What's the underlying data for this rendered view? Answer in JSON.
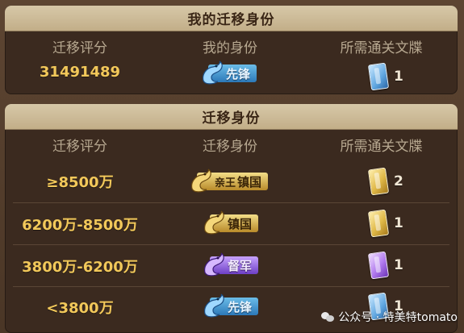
{
  "panel_mine": {
    "title": "我的迁移身份",
    "headers": [
      "迁移评分",
      "我的身份",
      "所需通关文牒"
    ],
    "score": "31491489",
    "identity": "先锋",
    "identity_style": "blue",
    "pass_count": "1",
    "pass_style": "blue"
  },
  "panel_table": {
    "title": "迁移身份",
    "headers": [
      "迁移评分",
      "迁移身份",
      "所需通关文牒"
    ],
    "rows": [
      {
        "score": "≥8500万",
        "identity": "镇国",
        "identity_prefix": "亲王",
        "identity_style": "gold",
        "pass_count": "2",
        "pass_style": "gold"
      },
      {
        "score": "6200万-8500万",
        "identity": "镇国",
        "identity_prefix": "",
        "identity_style": "gold",
        "pass_count": "1",
        "pass_style": "gold"
      },
      {
        "score": "3800万-6200万",
        "identity": "督军",
        "identity_prefix": "",
        "identity_style": "purple",
        "pass_count": "1",
        "pass_style": "purple"
      },
      {
        "score": "<3800万",
        "identity": "先锋",
        "identity_prefix": "",
        "identity_style": "blue",
        "pass_count": "1",
        "pass_style": "blue"
      }
    ]
  },
  "watermark": {
    "text": "公众号 · 特美特tomato"
  },
  "colors": {
    "score_gold": "#f2c85a",
    "header_text": "#b7a890",
    "panel_bg": "#3b2a1f",
    "title_bg": "#d7c8a8"
  }
}
